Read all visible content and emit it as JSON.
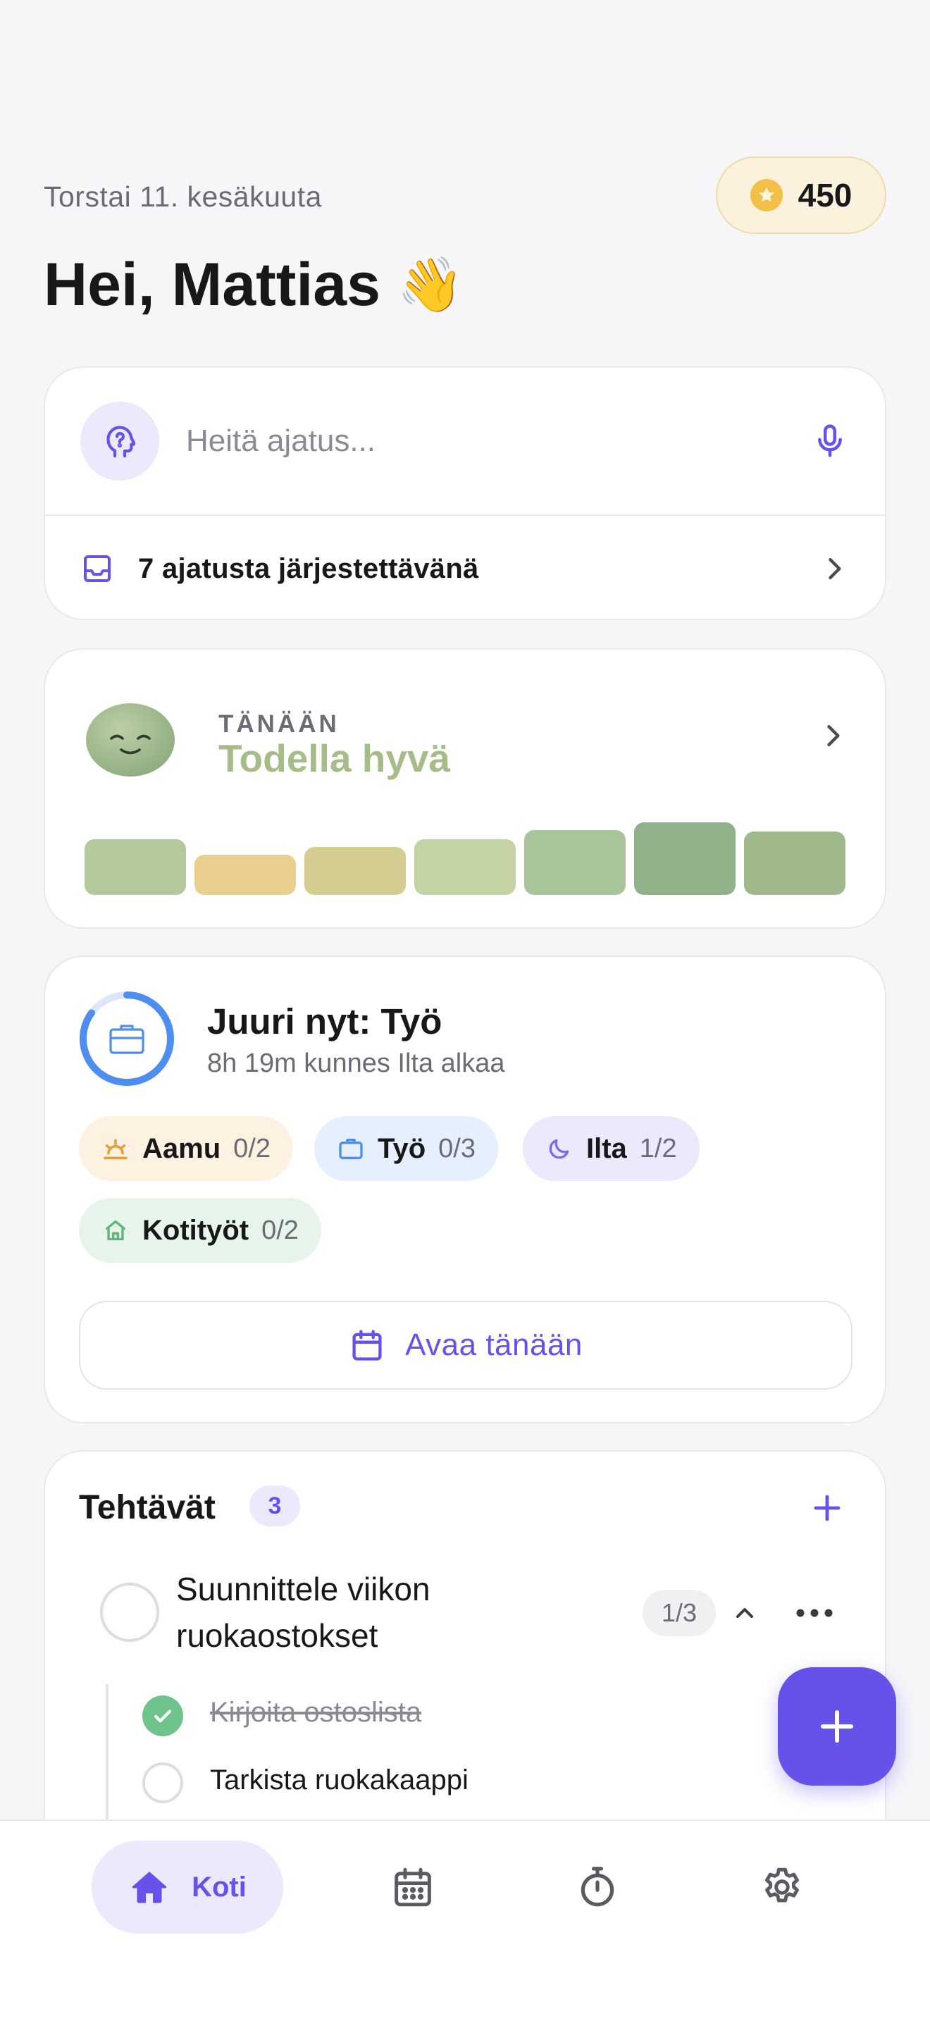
{
  "header": {
    "date": "Torstai 11. kesäkuuta",
    "greeting": "Hei, Mattias",
    "greeting_emoji": "👋",
    "points": "450"
  },
  "capture": {
    "placeholder": "Heitä ajatus...",
    "inbox_label": "7 ajatusta järjestettävänä"
  },
  "mood": {
    "kicker": "TÄNÄÄN",
    "value": "Todella hyvä",
    "value_color": "#a6bd8a",
    "week": [
      {
        "level": 0.72,
        "color": "#b3c89b"
      },
      {
        "level": 0.52,
        "color": "#ebcf8f"
      },
      {
        "level": 0.62,
        "color": "#d4cd92"
      },
      {
        "level": 0.72,
        "color": "#c3d3a4"
      },
      {
        "level": 0.84,
        "color": "#a9c49b"
      },
      {
        "level": 0.94,
        "color": "#90b18a"
      },
      {
        "level": 0.82,
        "color": "#9fb98a"
      }
    ]
  },
  "now": {
    "title": "Juuri nyt: Työ",
    "subtitle": "8h 19m kunnes Ilta alkaa",
    "progress": 0.85,
    "chips": [
      {
        "name": "Aamu",
        "count": "0/2",
        "icon": "sunrise-icon"
      },
      {
        "name": "Työ",
        "count": "0/3",
        "icon": "briefcase-icon"
      },
      {
        "name": "Ilta",
        "count": "1/2",
        "icon": "moon-icon"
      },
      {
        "name": "Kotityöt",
        "count": "0/2",
        "icon": "house-icon"
      }
    ],
    "open_label": "Avaa tänään"
  },
  "tasks": {
    "title": "Tehtävät",
    "count": "3",
    "items": [
      {
        "text": "Suunnittele viikon ruokaostokset",
        "progress": "1/3",
        "subtasks": [
          {
            "text": "Kirjoita ostoslista",
            "done": true
          },
          {
            "text": "Tarkista ruokakaappi",
            "done": false
          }
        ]
      }
    ]
  },
  "nav": {
    "home_label": "Koti"
  },
  "colors": {
    "accent": "#6552ea",
    "accent_soft": "#ece9fd"
  }
}
